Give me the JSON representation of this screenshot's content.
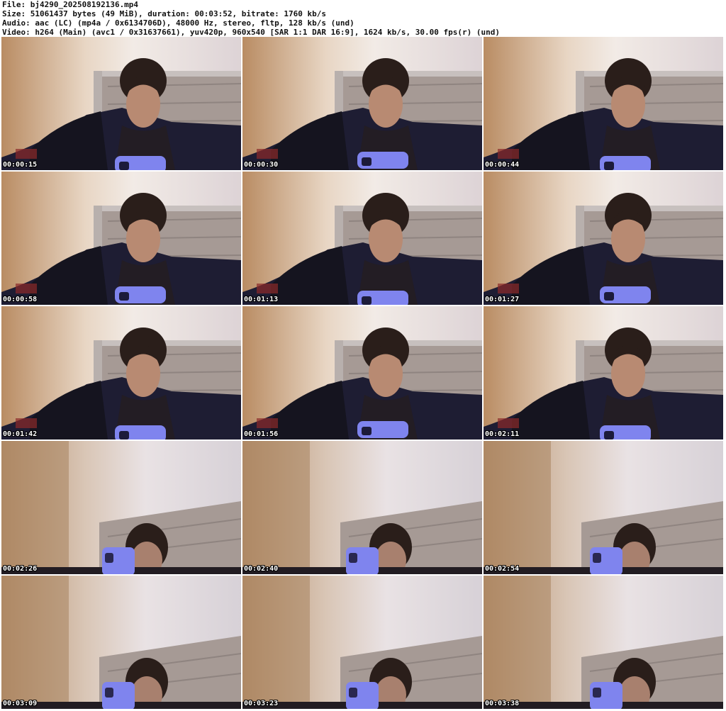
{
  "info": {
    "file": "File: bj4290_202508192136.mp4",
    "size": "Size: 51061437 bytes (49 MiB), duration: 00:03:52, bitrate: 1760 kb/s",
    "audio": "Audio: aac (LC) (mp4a / 0x6134706D), 48000 Hz, stereo, fltp, 128 kb/s (und)",
    "video": "Video: h264 (Main) (avc1 / 0x31637661), yuv420p, 960x540 [SAR 1:1 DAR 16:9], 1624 kb/s, 30.00 fps(r) (und)"
  },
  "thumbnails": [
    {
      "time": "00:00:15",
      "scene": "sitting"
    },
    {
      "time": "00:00:30",
      "scene": "sitting"
    },
    {
      "time": "00:00:44",
      "scene": "sitting"
    },
    {
      "time": "00:00:58",
      "scene": "sitting"
    },
    {
      "time": "00:01:13",
      "scene": "sitting"
    },
    {
      "time": "00:01:27",
      "scene": "sitting"
    },
    {
      "time": "00:01:42",
      "scene": "sitting"
    },
    {
      "time": "00:01:56",
      "scene": "sitting"
    },
    {
      "time": "00:02:11",
      "scene": "sitting"
    },
    {
      "time": "00:02:26",
      "scene": "low"
    },
    {
      "time": "00:02:40",
      "scene": "low"
    },
    {
      "time": "00:02:54",
      "scene": "low"
    },
    {
      "time": "00:03:09",
      "scene": "low"
    },
    {
      "time": "00:03:23",
      "scene": "low"
    },
    {
      "time": "00:03:38",
      "scene": "low"
    }
  ],
  "colors": {
    "wall": "#c9a585",
    "headboard": "#a69a95",
    "pillow": "#1e1d33",
    "phone": "#7f84ee"
  }
}
